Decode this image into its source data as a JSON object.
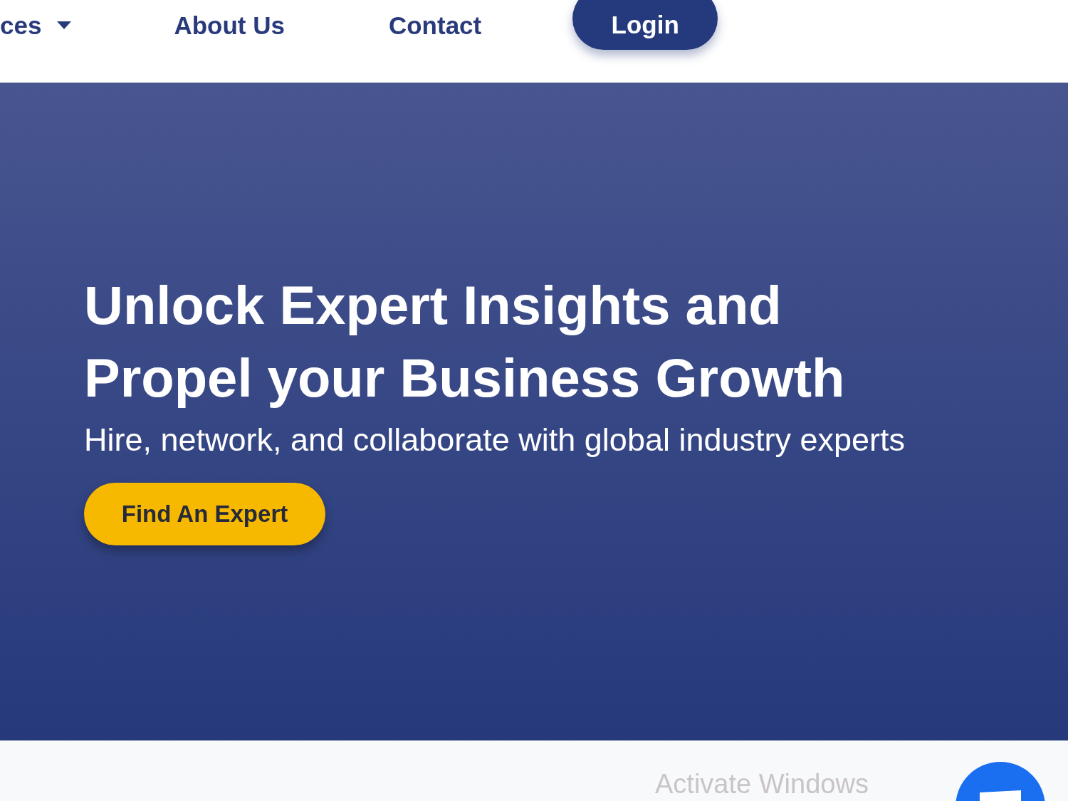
{
  "nav": {
    "items": [
      {
        "label": "ces",
        "kind": "dropdown"
      },
      {
        "label": "About Us",
        "kind": "link"
      },
      {
        "label": "Contact",
        "kind": "link"
      }
    ],
    "login": "Login"
  },
  "hero": {
    "title_lines": [
      "Unlock Expert Insights and",
      "Propel your Business Growth"
    ],
    "subtitle": "Hire, network, and collaborate with global industry experts",
    "button": "Find An Expert"
  },
  "footer_overlay": {
    "text": "Activate Windows"
  }
}
